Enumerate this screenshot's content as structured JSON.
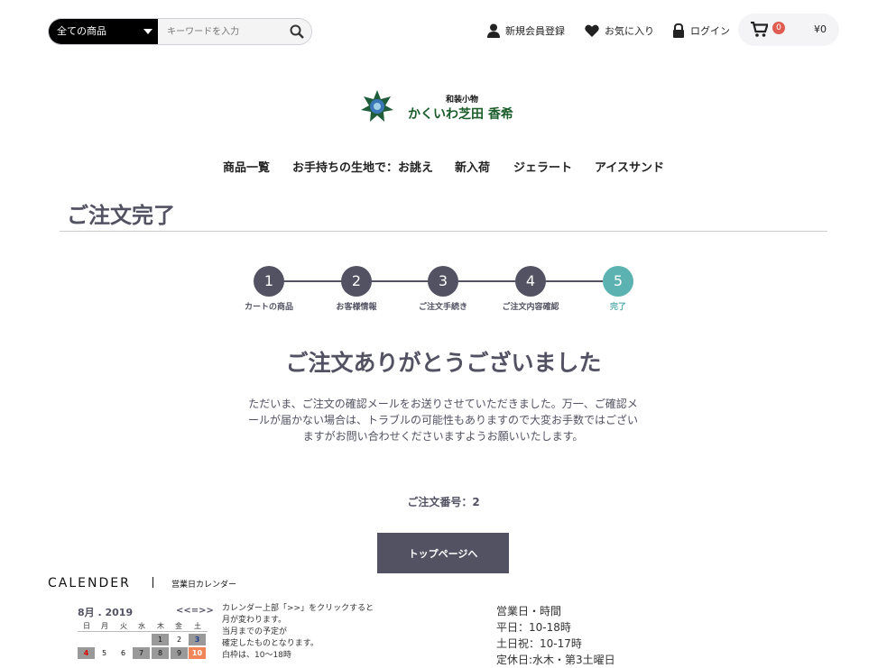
{
  "search": {
    "category": "全ての商品",
    "placeholder": "キーワードを入力"
  },
  "header": {
    "register": "新規会員登録",
    "favorites": "お気に入り",
    "login": "ログイン",
    "cart_count": "0",
    "cart_total": "¥0"
  },
  "logo": {
    "small": "和装小物",
    "big": "かくいわ芝田 香希"
  },
  "nav": [
    "商品一覧",
    "お手持ちの生地で：お誂え",
    "新入荷",
    "ジェラート",
    "アイスサンド"
  ],
  "page_title": "ご注文完了",
  "steps": [
    {
      "num": "1",
      "label": "カートの商品"
    },
    {
      "num": "2",
      "label": "お客様情報"
    },
    {
      "num": "3",
      "label": "ご注文手続き"
    },
    {
      "num": "4",
      "label": "ご注文内容確認"
    },
    {
      "num": "5",
      "label": "完了"
    }
  ],
  "thanks": "ご注文ありがとうございました",
  "message": "ただいま、ご注文の確認メールをお送りさせていただきました。万一、ご確認メールが届かない場合は、トラブルの可能性もありますので大変お手数ではございますがお問い合わせくださいますようお願いいたします。",
  "order_number": "ご注文番号：2",
  "top_button": "トップページへ",
  "calendar": {
    "heading": "CALENDER",
    "subheading": "営業日カレンダー",
    "month": "8月 . 2019",
    "nav": "<<=>>",
    "weekdays": [
      "日",
      "月",
      "火",
      "水",
      "木",
      "金",
      "土"
    ],
    "row1": [
      "",
      "",
      "",
      "",
      "1",
      "2",
      "3"
    ],
    "row2": [
      "4",
      "5",
      "6",
      "7",
      "8",
      "9",
      "10"
    ],
    "note_lines": [
      "カレンダー上部「>>」をクリックすると",
      "月が変わります。",
      "当月までの予定が",
      "確定したものとなります。",
      "白枠は、10〜18時"
    ]
  },
  "hours": {
    "title": "営業日・時間",
    "weekday": "平日：10-18時",
    "weekend": "土日祝：10-17時",
    "closed": "定休日:水木・第3土曜日"
  },
  "colors": {
    "primary": "#525263",
    "active_step": "#5cb1b1",
    "badge": "#de5d50"
  }
}
